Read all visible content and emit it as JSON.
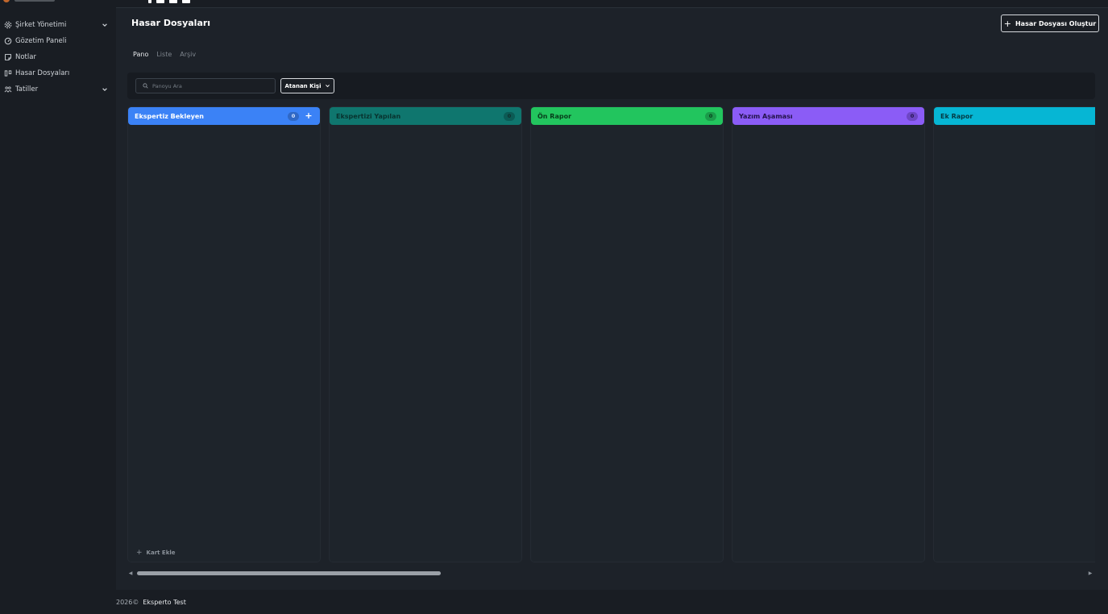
{
  "sidebar": {
    "items": [
      {
        "label": "Şirket Yönetimi",
        "icon": "gear-icon",
        "has_children": true
      },
      {
        "label": "Gözetim Paneli",
        "icon": "gauge-icon",
        "has_children": false
      },
      {
        "label": "Notlar",
        "icon": "note-icon",
        "has_children": false
      },
      {
        "label": "Hasar Dosyaları",
        "icon": "kanban-icon",
        "has_children": false
      },
      {
        "label": "Tatiller",
        "icon": "people-icon",
        "has_children": true
      }
    ]
  },
  "header": {
    "title": "Hasar Dosyaları",
    "create_label": "Hasar Dosyası Oluştur"
  },
  "tabs": [
    {
      "label": "Pano",
      "active": true
    },
    {
      "label": "Liste",
      "active": false
    },
    {
      "label": "Arşiv",
      "active": false
    }
  ],
  "filters": {
    "search_placeholder": "Panoyu Ara",
    "assignee_label": "Atanan Kişi"
  },
  "board": {
    "add_card_label": "Kart Ekle",
    "columns": [
      {
        "title": "Ekspertiz Bekleyen",
        "count": "0",
        "color": "#3b82f6",
        "text_color": "#ffffff",
        "badge_bg": "#2f68c6",
        "badge_text": "#dbe8ff",
        "show_add": true
      },
      {
        "title": "Ekspertizi Yapılan",
        "count": "0",
        "color": "#0f766e",
        "text_color": "#08332f",
        "badge_bg": "#0b5b55",
        "badge_text": "#0f2d2a",
        "show_add": false
      },
      {
        "title": "Ön Rapor",
        "count": "0",
        "color": "#22c55e",
        "text_color": "#073d1b",
        "badge_bg": "#1b9b4a",
        "badge_text": "#073d1b",
        "show_add": false
      },
      {
        "title": "Yazım Aşaması",
        "count": "0",
        "color": "#8b5cf6",
        "text_color": "#22124a",
        "badge_bg": "#6d46c4",
        "badge_text": "#22124a",
        "show_add": false
      },
      {
        "title": "Ek Rapor",
        "count": "",
        "color": "#06b6d4",
        "text_color": "#053a44",
        "badge_bg": "#058ea6",
        "badge_text": "#053a44",
        "show_add": false
      }
    ]
  },
  "scroll": {
    "thumb_fraction": 0.32
  },
  "footer": {
    "year": "2026©",
    "company": "Eksperto Test"
  }
}
